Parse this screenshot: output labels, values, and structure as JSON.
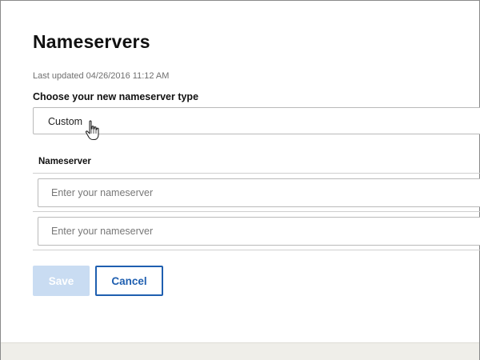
{
  "page": {
    "title": "Nameservers",
    "last_updated": "Last updated 04/26/2016 11:12 AM"
  },
  "nameserver_type": {
    "label": "Choose your new nameserver type",
    "selected": "Custom"
  },
  "nameservers": {
    "header": "Nameserver",
    "rows": [
      {
        "value": "",
        "placeholder": "Enter your nameserver"
      },
      {
        "value": "",
        "placeholder": "Enter your nameserver"
      }
    ]
  },
  "actions": {
    "save_label": "Save",
    "cancel_label": "Cancel"
  },
  "colors": {
    "accent": "#1f5fb0",
    "save_disabled_bg": "#c9dcf2",
    "footer_bg": "#efeee9"
  },
  "icons": {
    "cursor": "hand-pointer-icon"
  }
}
